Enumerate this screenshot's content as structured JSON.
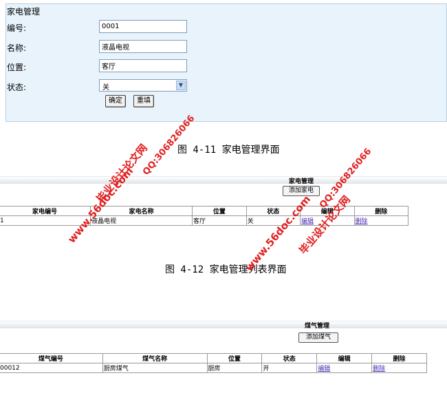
{
  "form": {
    "title": "家电管理",
    "fields": [
      {
        "label": "编号:",
        "value": "0001"
      },
      {
        "label": "名称:",
        "value": "液晶电视"
      },
      {
        "label": "位置:",
        "value": "客厅"
      },
      {
        "label": "状态:",
        "value": "关"
      }
    ],
    "confirm_label": "确定",
    "reset_label": "重填"
  },
  "captions": {
    "fig_4_11": "图 4-11 家电管理界面",
    "fig_4_12": "图 4-12 家电管理列表界面"
  },
  "appliance_list": {
    "title": "家电管理",
    "add_button": "添加家电",
    "headers": [
      "家电编号",
      "家电名称",
      "位置",
      "状态",
      "编辑",
      "删除"
    ],
    "rows": [
      {
        "id": "1",
        "name": "液晶电视",
        "location": "客厅",
        "status": "关",
        "edit": "编辑",
        "delete": "删除"
      }
    ]
  },
  "gas_list": {
    "title": "煤气管理",
    "add_button": "添加煤气",
    "headers": [
      "煤气编号",
      "煤气名称",
      "位置",
      "状态",
      "编辑",
      "删除"
    ],
    "rows": [
      {
        "id": "00012",
        "name": "厨房煤气",
        "location": "厨房",
        "status": "开",
        "edit": "编辑",
        "delete": "删除"
      }
    ]
  },
  "watermark": {
    "site": "www.56doc.com",
    "qq": "QQ:306826066",
    "brand": "毕业设计论文网"
  }
}
